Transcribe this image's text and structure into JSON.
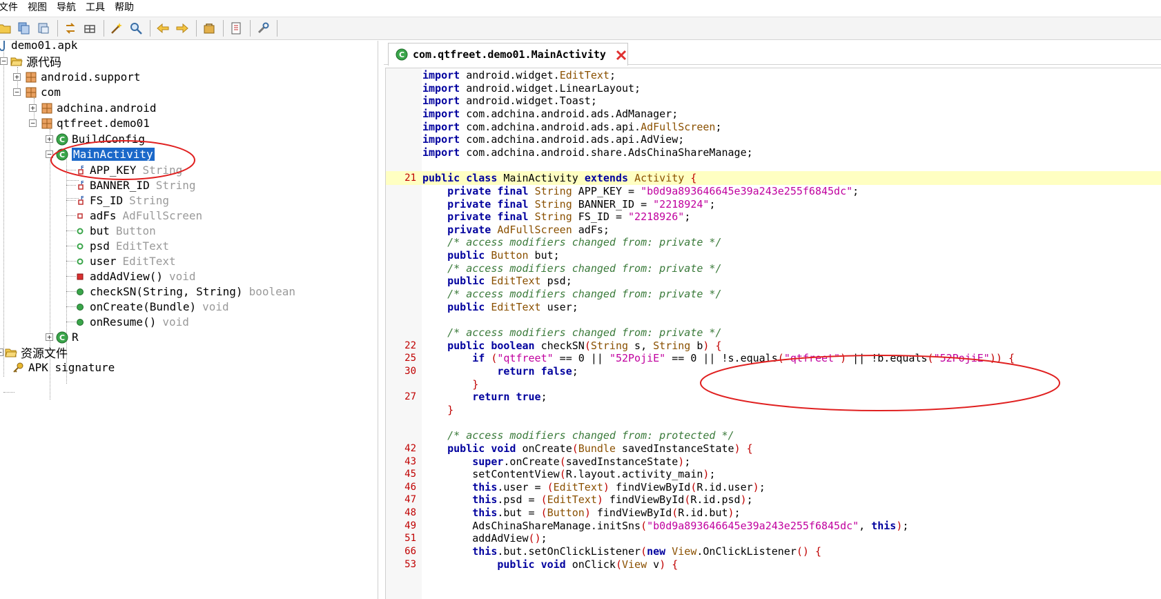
{
  "menu": [
    "文件",
    "视图",
    "导航",
    "工具",
    "帮助"
  ],
  "toolbar": {
    "buttons": [
      "open-file-icon",
      "save-all-icon",
      "export-icon",
      "sync-icon",
      "flatten-packages-icon",
      "magic-wand-icon",
      "search-icon",
      "back-icon",
      "forward-icon",
      "deobfuscation-icon",
      "log-icon",
      "preferences-icon"
    ]
  },
  "tree": {
    "root": "demo01.apk",
    "source_code": "源代码",
    "android_support": "android.support",
    "com": "com",
    "adchina_android": "adchina.android",
    "qtfreet_demo01": "qtfreet.demo01",
    "build_config": "BuildConfig",
    "main_activity": "MainActivity",
    "members": [
      {
        "name": "APP_KEY",
        "type": "String",
        "icon": "static-final-field"
      },
      {
        "name": "BANNER_ID",
        "type": "String",
        "icon": "static-final-field"
      },
      {
        "name": "FS_ID",
        "type": "String",
        "icon": "static-final-field"
      },
      {
        "name": "adFs",
        "type": "AdFullScreen",
        "icon": "private-field"
      },
      {
        "name": "but",
        "type": "Button",
        "icon": "public-field"
      },
      {
        "name": "psd",
        "type": "EditText",
        "icon": "public-field"
      },
      {
        "name": "user",
        "type": "EditText",
        "icon": "public-field"
      },
      {
        "name": "addAdView()",
        "type": "void",
        "icon": "private-method"
      },
      {
        "name": "checkSN(String, String)",
        "type": "boolean",
        "icon": "public-method"
      },
      {
        "name": "onCreate(Bundle)",
        "type": "void",
        "icon": "public-method"
      },
      {
        "name": "onResume()",
        "type": "void",
        "icon": "public-method"
      }
    ],
    "r_class": "R",
    "resources": "资源文件",
    "apk_signature": "APK signature"
  },
  "editor": {
    "tab_title": "com.qtfreet.demo01.MainActivity"
  },
  "code": [
    {
      "ln": "",
      "text": "import android.widget.EditText;"
    },
    {
      "ln": "",
      "text": "import android.widget.LinearLayout;"
    },
    {
      "ln": "",
      "text": "import android.widget.Toast;"
    },
    {
      "ln": "",
      "text": "import com.adchina.android.ads.AdManager;"
    },
    {
      "ln": "",
      "text": "import com.adchina.android.ads.api.AdFullScreen;"
    },
    {
      "ln": "",
      "text": "import com.adchina.android.ads.api.AdView;"
    },
    {
      "ln": "",
      "text": "import com.adchina.android.share.AdsChinaShareManage;"
    },
    {
      "ln": "",
      "text": ""
    },
    {
      "ln": "21",
      "text": "public class MainActivity extends Activity {"
    },
    {
      "ln": "",
      "text": "    private final String APP_KEY = \"b0d9a893646645e39a243e255f6845dc\";"
    },
    {
      "ln": "",
      "text": "    private final String BANNER_ID = \"2218924\";"
    },
    {
      "ln": "",
      "text": "    private final String FS_ID = \"2218926\";"
    },
    {
      "ln": "",
      "text": "    private AdFullScreen adFs;"
    },
    {
      "ln": "",
      "text": "    /* access modifiers changed from: private */"
    },
    {
      "ln": "",
      "text": "    public Button but;"
    },
    {
      "ln": "",
      "text": "    /* access modifiers changed from: private */"
    },
    {
      "ln": "",
      "text": "    public EditText psd;"
    },
    {
      "ln": "",
      "text": "    /* access modifiers changed from: private */"
    },
    {
      "ln": "",
      "text": "    public EditText user;"
    },
    {
      "ln": "",
      "text": ""
    },
    {
      "ln": "",
      "text": "    /* access modifiers changed from: private */"
    },
    {
      "ln": "22",
      "text": "    public boolean checkSN(String s, String b) {"
    },
    {
      "ln": "25",
      "text": "        if (\"qtfreet\" == 0 || \"52PojiE\" == 0 || !s.equals(\"qtfreet\") || !b.equals(\"52PojiE\")) {"
    },
    {
      "ln": "30",
      "text": "            return false;"
    },
    {
      "ln": "",
      "text": "        }"
    },
    {
      "ln": "27",
      "text": "        return true;"
    },
    {
      "ln": "",
      "text": "    }"
    },
    {
      "ln": "",
      "text": ""
    },
    {
      "ln": "",
      "text": "    /* access modifiers changed from: protected */"
    },
    {
      "ln": "42",
      "text": "    public void onCreate(Bundle savedInstanceState) {"
    },
    {
      "ln": "43",
      "text": "        super.onCreate(savedInstanceState);"
    },
    {
      "ln": "45",
      "text": "        setContentView(R.layout.activity_main);"
    },
    {
      "ln": "46",
      "text": "        this.user = (EditText) findViewById(R.id.user);"
    },
    {
      "ln": "47",
      "text": "        this.psd = (EditText) findViewById(R.id.psd);"
    },
    {
      "ln": "48",
      "text": "        this.but = (Button) findViewById(R.id.but);"
    },
    {
      "ln": "49",
      "text": "        AdsChinaShareManage.initSns(\"b0d9a893646645e39a243e255f6845dc\", this);"
    },
    {
      "ln": "51",
      "text": "        addAdView();"
    },
    {
      "ln": "66",
      "text": "        this.but.setOnClickListener(new View.OnClickListener() {"
    },
    {
      "ln": "53",
      "text": "            public void onClick(View v) {"
    }
  ],
  "colors": {
    "selection": "#1b68c9",
    "annotation": "#e02020",
    "highlight_line": "#ffffc2",
    "keyword": "#00009e",
    "string": "#c0009e",
    "comment": "#3a7a3a"
  }
}
